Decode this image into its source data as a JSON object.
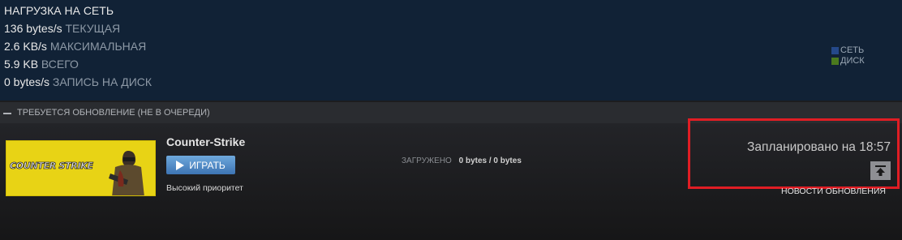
{
  "network": {
    "title": "НАГРУЗКА НА СЕТЬ",
    "current_value": "136 bytes/s",
    "current_label": "ТЕКУЩАЯ",
    "max_value": "2.6 KB/s",
    "max_label": "МАКСИМАЛЬНАЯ",
    "total_value": "5.9 KB",
    "total_label": "ВСЕГО",
    "disk_value": "0 bytes/s",
    "disk_label": "ЗАПИСЬ НА ДИСК",
    "legend": [
      {
        "label": "СЕТЬ",
        "color": "#25498a"
      },
      {
        "label": "ДИСК",
        "color": "#4b7a1e"
      }
    ]
  },
  "section": {
    "title": "ТРЕБУЕТСЯ ОБНОВЛЕНИЕ (НЕ В ОЧЕРЕДИ)"
  },
  "game": {
    "banner_logo": "COUNTER STRIKE",
    "name": "Counter-Strike",
    "play_label": "ИГРАТЬ",
    "priority": "Высокий приоритет",
    "loaded_label": "ЗАГРУЖЕНО",
    "loaded_value": "0 bytes / 0 bytes",
    "scheduled": "Запланировано на 18:57",
    "news_label": "НОВОСТИ ОБНОВЛЕНИЯ",
    "move_top_icon": "arrow-to-top-icon",
    "accent_color": "#e01d24"
  }
}
